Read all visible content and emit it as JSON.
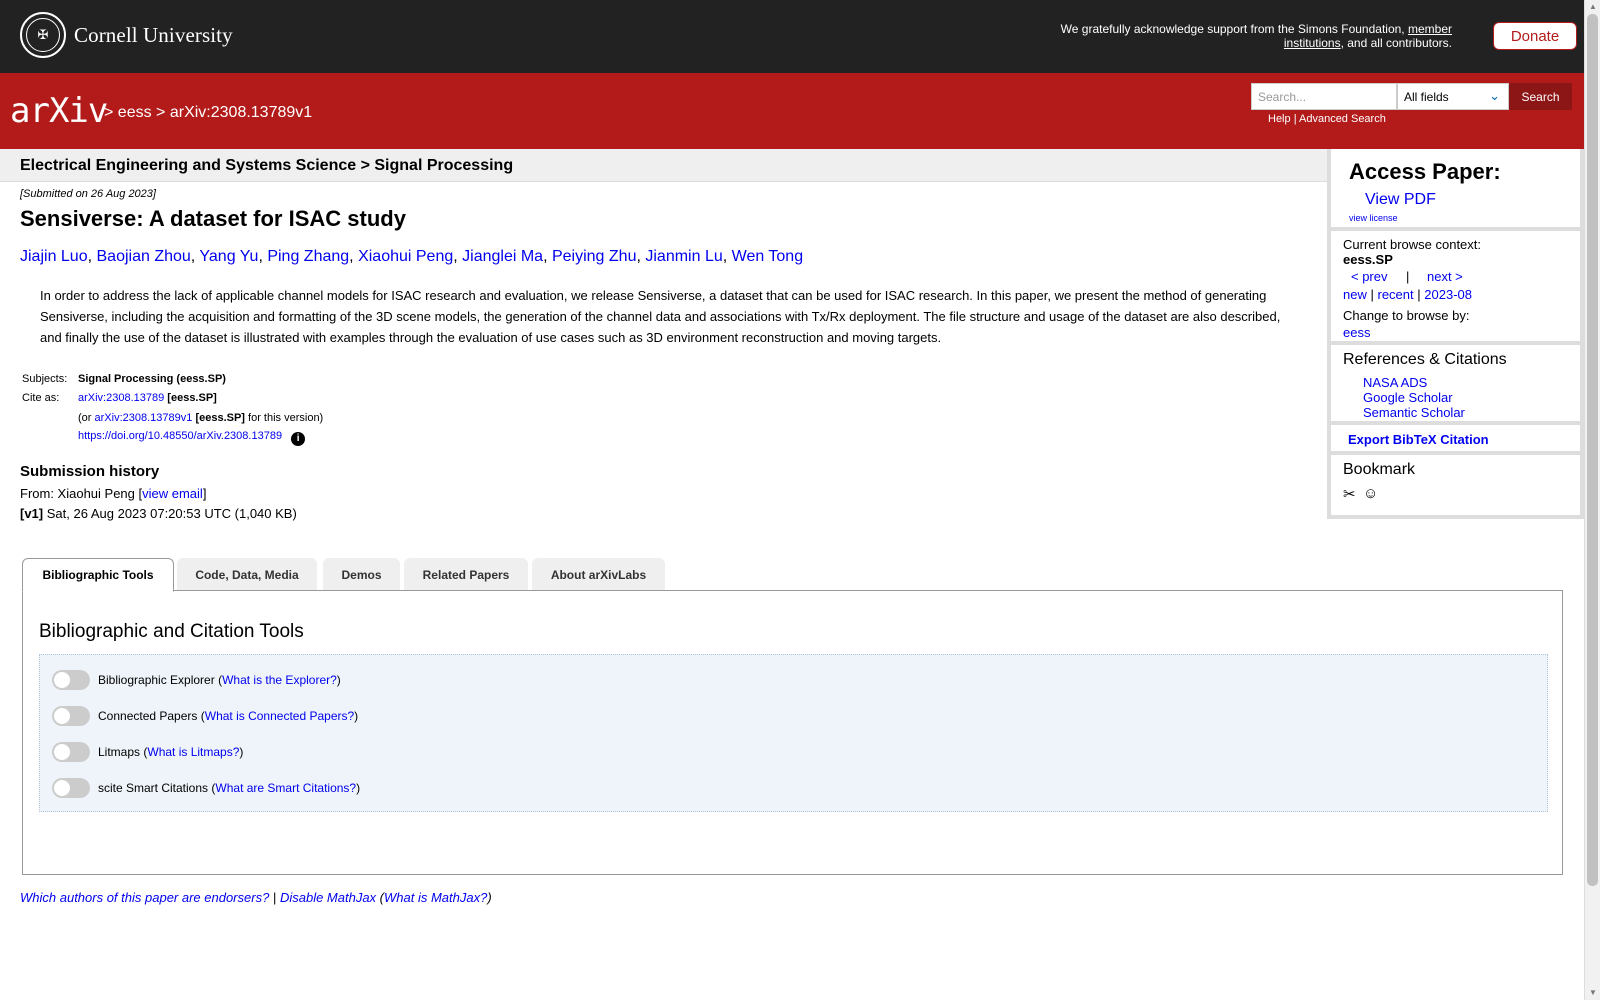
{
  "cornell": {
    "name": "Cornell University",
    "seal_glyph": "✠",
    "ack_prefix": "We gratefully acknowledge support from the Simons Foundation,",
    "ack_link": "member institutions",
    "ack_suffix": ", and all contributors.",
    "donate_label": "Donate"
  },
  "header": {
    "logo_text": "arXiv",
    "crumb_sep": ">",
    "crumb_1": "eess",
    "crumb_2": "arXiv:2308.13789v1",
    "search_placeholder": "Search...",
    "field_selected": "All fields",
    "search_label": "Search",
    "help_label": "Help",
    "help_sep": "|",
    "advanced_label": "Advanced Search"
  },
  "subject_bar": "Electrical Engineering and Systems Science > Signal Processing",
  "paper": {
    "submitted": "[Submitted on 26 Aug 2023]",
    "title": "Sensiverse: A dataset for ISAC study",
    "authors": [
      "Jiajin Luo",
      "Baojian Zhou",
      "Yang Yu",
      "Ping Zhang",
      "Xiaohui Peng",
      "Jianglei Ma",
      "Peiying Zhu",
      "Jianmin Lu",
      "Wen Tong"
    ],
    "abstract": "In order to address the lack of applicable channel models for ISAC research and evaluation, we release Sensiverse, a dataset that can be used for ISAC research. In this paper, we present the method of generating Sensiverse, including the acquisition and formatting of the 3D scene models, the generation of the channel data and associations with Tx/Rx deployment. The file structure and usage of the dataset are also described, and finally the use of the dataset is illustrated with examples through the evaluation of use cases such as 3D environment reconstruction and moving targets.",
    "subjects_label": "Subjects:",
    "subjects_value": "Signal Processing (eess.SP)",
    "cite_label": "Cite as:",
    "cite_id": "arXiv:2308.13789",
    "cite_tag": "[eess.SP]",
    "cite_or": "(or",
    "cite_version_id": "arXiv:2308.13789v1",
    "cite_version_suffix": "for this version)",
    "doi": "https://doi.org/10.48550/arXiv.2308.13789",
    "info_glyph": "i"
  },
  "history": {
    "heading": "Submission history",
    "from_label": "From: Xiaohui Peng [",
    "view_email": "view email",
    "from_close": "]",
    "v1_label": "[v1]",
    "v1_text": "Sat, 26 Aug 2023 07:20:53 UTC (1,040 KB)"
  },
  "sidebar": {
    "access_heading": "Access Paper:",
    "view_pdf": "View PDF",
    "view_license": "view license",
    "context_label": "Current browse context:",
    "context_value": "eess.SP",
    "prev": "< prev",
    "pipe": "|",
    "next": "next >",
    "new": "new",
    "recent": "recent",
    "month": "2023-08",
    "change_label": "Change to browse by:",
    "change_value": "eess",
    "refs_heading": "References & Citations",
    "refs": [
      "NASA ADS",
      "Google Scholar",
      "Semantic Scholar"
    ],
    "export": "Export BibTeX Citation",
    "bookmark_heading": "Bookmark",
    "bookmark_icons": [
      "✂",
      "☺"
    ]
  },
  "tabs": [
    "Bibliographic Tools",
    "Code, Data, Media",
    "Demos",
    "Related Papers",
    "About arXivLabs"
  ],
  "tools": {
    "heading": "Bibliographic and Citation Tools",
    "rows": [
      {
        "label": "Bibliographic Explorer",
        "link": "What is the Explorer?"
      },
      {
        "label": "Connected Papers",
        "link": "What is Connected Papers?"
      },
      {
        "label": "Litmaps",
        "link": "What is Litmaps?"
      },
      {
        "label": "scite Smart Citations",
        "link": "What are Smart Citations?"
      }
    ]
  },
  "footer": {
    "endorsers": "Which authors of this paper are endorsers?",
    "sep": "|",
    "disable_mathjax": "Disable MathJax",
    "what_mathjax": "What is MathJax?"
  },
  "scrollbar": {
    "up": "▲",
    "down": "▼"
  },
  "colors": {
    "arxiv_red": "#b31b1b",
    "cornell_bar": "#222222",
    "link": "#0000ee"
  }
}
